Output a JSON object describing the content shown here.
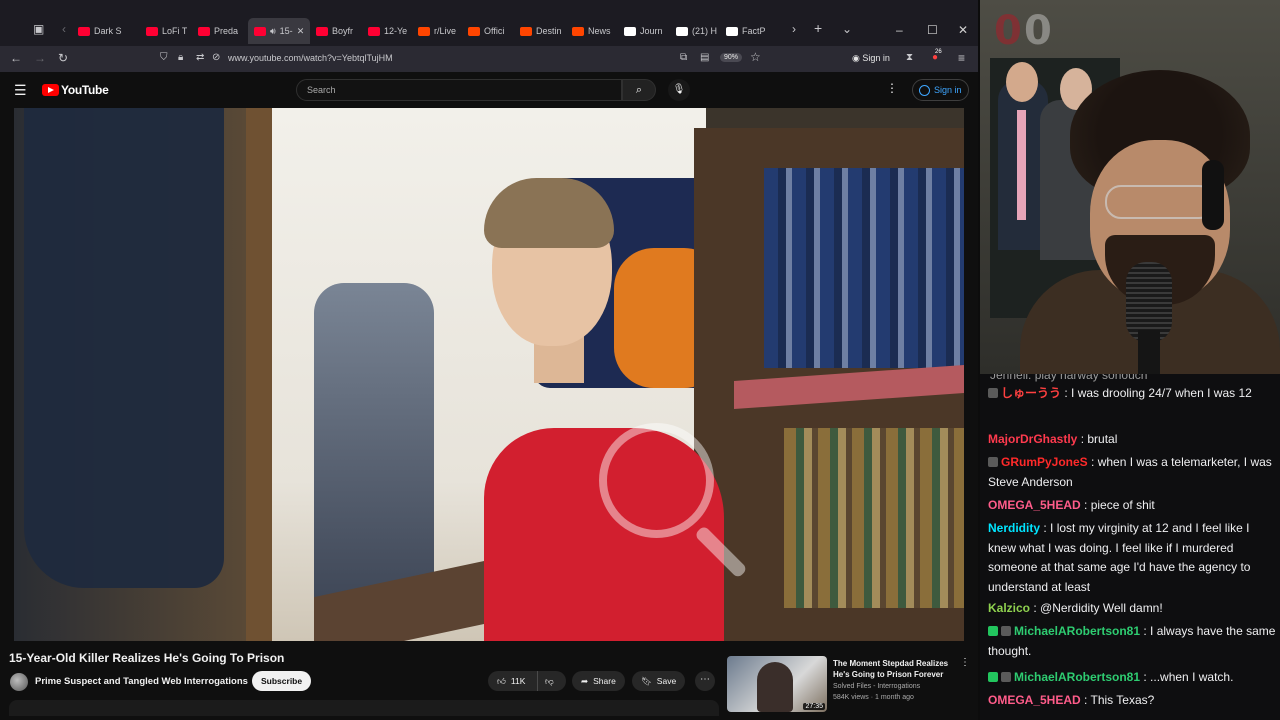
{
  "browser": {
    "tabs": [
      {
        "label": "Dark S",
        "color": "#ff0033"
      },
      {
        "label": "LoFi T",
        "color": "#ff0033"
      },
      {
        "label": "Preda",
        "color": "#ff0033"
      },
      {
        "label": "15-",
        "color": "#ff0033",
        "active": true
      },
      {
        "label": "Boyfr",
        "color": "#ff0033"
      },
      {
        "label": "12-Ye",
        "color": "#ff0033"
      },
      {
        "label": "r/Live",
        "color": "#ff4500"
      },
      {
        "label": "Offici",
        "color": "#ff4500"
      },
      {
        "label": "Destin",
        "color": "#ff4500"
      },
      {
        "label": "News",
        "color": "#ff4500"
      },
      {
        "label": "Journ",
        "color": "#ffffff"
      },
      {
        "label": "(21) H",
        "color": "#ffffff"
      },
      {
        "label": "FactP",
        "color": "#ffffff"
      }
    ],
    "url": "www.youtube.com/watch?v=YebtqlTujHM",
    "zoom": "90%",
    "signin_label": "Sign in",
    "notif_count": "26"
  },
  "youtube": {
    "logo_text": "YouTube",
    "search_placeholder": "Search",
    "signin_label": "Sign in"
  },
  "video": {
    "title": "15-Year-Old Killer Realizes He's Going To Prison",
    "channel": "Prime Suspect and Tangled Web Interrogations",
    "subscribe_label": "Subscribe",
    "likes": "11K",
    "share_label": "Share",
    "save_label": "Save"
  },
  "recommendation": {
    "title": "The Moment Stepdad Realizes He's Going to Prison Forever",
    "channel": "Solved Files - Interrogations",
    "meta": "584K views · 1 month ago",
    "duration": "27:35"
  },
  "stream_overlay": {
    "logo_digits": [
      "0",
      "0"
    ]
  },
  "chat": {
    "cut_line": "Jennell: play harway sohouch",
    "messages": [
      {
        "user": "しゅーうう",
        "text": ": I was drooling 24/7 when I was 12",
        "color": "#ff4040",
        "badges": [
          "#5a5a5a"
        ]
      },
      {
        "user": "MajorDrGhastly",
        "text": ": brutal",
        "color": "#ff3a4e",
        "badges": []
      },
      {
        "user": "GRumPyJoneS",
        "text": ": when I was a telemarketer, I was Steve Anderson",
        "color": "#ff2a2a",
        "badges": [
          "#5a5a5a"
        ]
      },
      {
        "user": "OMEGA_5HEAD",
        "text": ": piece of shit",
        "color": "#ff5c8a",
        "badges": []
      },
      {
        "user": "Nerdidity",
        "text": ": I lost my virginity at 12 and I feel like I knew what I was doing. I feel like if I murdered someone at that same age I'd have the agency to understand at least",
        "color": "#00e5ff",
        "badges": []
      },
      {
        "user": "Kalzico",
        "text": ": @Nerdidity Well damn!",
        "color": "#8fd14f",
        "badges": []
      },
      {
        "user": "MichaelARobertson81",
        "text": ": I always have the same thought.",
        "color": "#2ecc71",
        "badges": [
          "#22c55e",
          "#5a5a5a"
        ]
      },
      {
        "user": "MichaelARobertson81",
        "text": ": ...when I watch.",
        "color": "#2ecc71",
        "badges": [
          "#22c55e",
          "#5a5a5a"
        ]
      },
      {
        "user": "OMEGA_5HEAD",
        "text": ": This Texas?",
        "color": "#ff5c8a",
        "badges": []
      }
    ]
  }
}
